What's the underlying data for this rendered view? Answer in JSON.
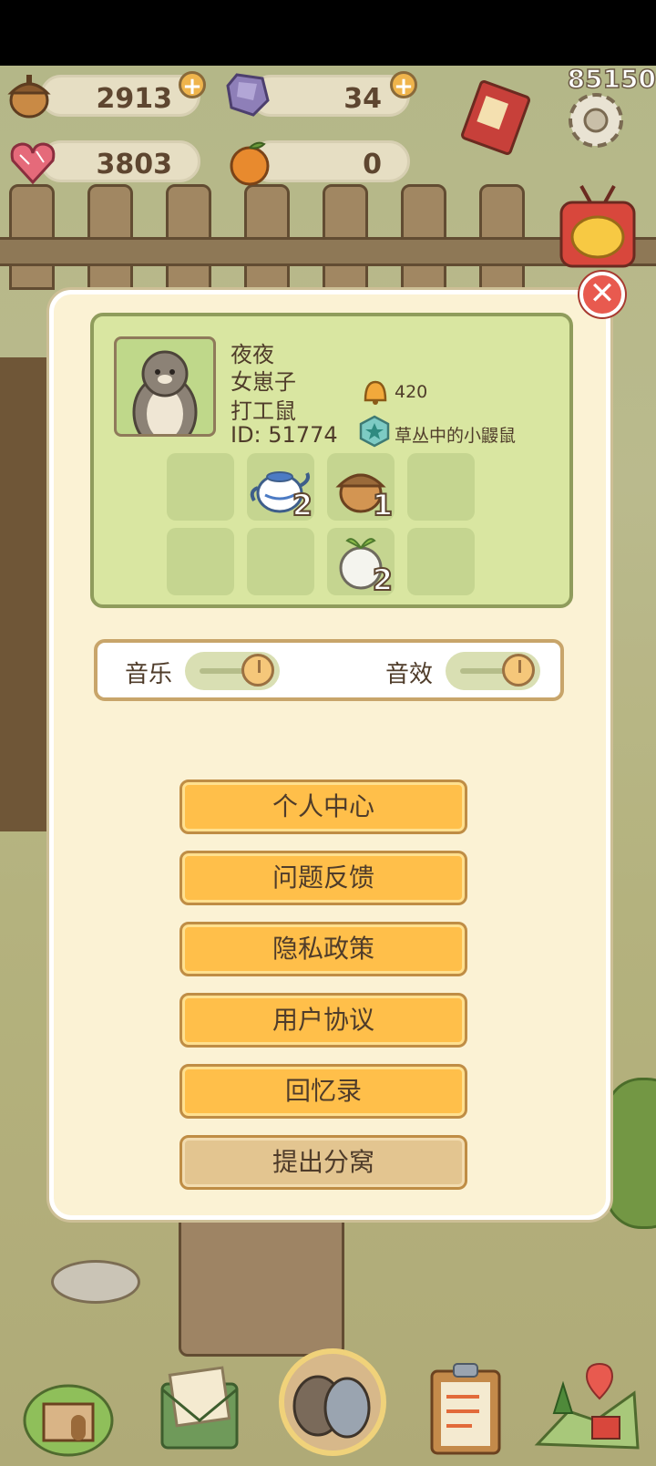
{
  "score": "85150",
  "currencies": {
    "acorn": "2913",
    "crystal": "34",
    "heart": "3803",
    "orange": "0"
  },
  "profile": {
    "name": "夜夜",
    "title1": "女崽子",
    "title2": "打工鼠",
    "id": "ID: 51774",
    "bells": "420",
    "badge": "草丛中的小鼹鼠"
  },
  "inventory": [
    {
      "icon": "teapot-icon",
      "count": "2"
    },
    {
      "icon": "acorn-icon",
      "count": "1"
    },
    {
      "icon": "turnip-icon",
      "count": "2"
    }
  ],
  "settings": {
    "music_label": "音乐",
    "sfx_label": "音效"
  },
  "menu": {
    "personal": "个人中心",
    "feedback": "问题反馈",
    "privacy": "隐私政策",
    "agreement": "用户协议",
    "memoir": "回忆录",
    "leave_nest": "提出分窝"
  },
  "colors": {
    "button": "#ffbf4a",
    "button_muted": "#e3c590",
    "panel": "#fbf2d4",
    "profile_bg": "#d9e6a1",
    "close": "#e85a4f"
  }
}
